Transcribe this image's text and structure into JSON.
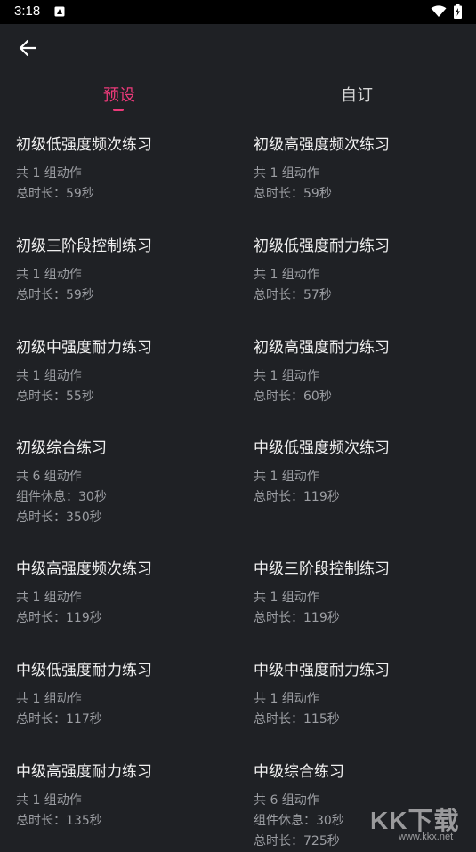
{
  "status_bar": {
    "time": "3:18",
    "icons": [
      "notification-icon",
      "wifi-icon",
      "battery-charging-icon"
    ]
  },
  "header": {
    "back_icon": "arrow-left-icon"
  },
  "tabs": [
    {
      "label": "预设",
      "selected": true
    },
    {
      "label": "自订",
      "selected": false
    }
  ],
  "colors": {
    "accent": "#ec3a7a",
    "background": "#1f2125",
    "status_bar": "#000000",
    "text_primary": "#f0f0f0",
    "text_secondary": "#9c9ea3"
  },
  "exercises": [
    {
      "title": "初级低强度频次练习",
      "lines": [
        "共 1 组动作",
        "总时长：59秒"
      ]
    },
    {
      "title": "初级高强度频次练习",
      "lines": [
        "共 1 组动作",
        "总时长：59秒"
      ]
    },
    {
      "title": "初级三阶段控制练习",
      "lines": [
        "共 1 组动作",
        "总时长：59秒"
      ]
    },
    {
      "title": "初级低强度耐力练习",
      "lines": [
        "共 1 组动作",
        "总时长：57秒"
      ]
    },
    {
      "title": "初级中强度耐力练习",
      "lines": [
        "共 1 组动作",
        "总时长：55秒"
      ]
    },
    {
      "title": "初级高强度耐力练习",
      "lines": [
        "共 1 组动作",
        "总时长：60秒"
      ]
    },
    {
      "title": "初级综合练习",
      "lines": [
        "共 6 组动作",
        "组件休息：30秒",
        "总时长：350秒"
      ]
    },
    {
      "title": "中级低强度频次练习",
      "lines": [
        "共 1 组动作",
        "总时长：119秒"
      ]
    },
    {
      "title": "中级高强度频次练习",
      "lines": [
        "共 1 组动作",
        "总时长：119秒"
      ]
    },
    {
      "title": "中级三阶段控制练习",
      "lines": [
        "共 1 组动作",
        "总时长：119秒"
      ]
    },
    {
      "title": "中级低强度耐力练习",
      "lines": [
        "共 1 组动作",
        "总时长：117秒"
      ]
    },
    {
      "title": "中级中强度耐力练习",
      "lines": [
        "共 1 组动作",
        "总时长：115秒"
      ]
    },
    {
      "title": "中级高强度耐力练习",
      "lines": [
        "共 1 组动作",
        "总时长：135秒"
      ]
    },
    {
      "title": "中级综合练习",
      "lines": [
        "共 6 组动作",
        "组件休息：30秒",
        "总时长：725秒"
      ]
    }
  ],
  "watermark": {
    "text": "KK下载",
    "url": "www.kkx.net"
  }
}
